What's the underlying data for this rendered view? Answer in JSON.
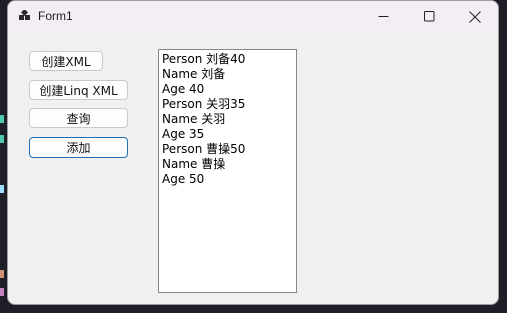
{
  "window": {
    "title": "Form1",
    "icon": "winforms-app-icon"
  },
  "caption_buttons": {
    "minimize": "minimize-icon",
    "maximize": "maximize-icon",
    "close": "close-icon"
  },
  "buttons": {
    "create_xml": "创建XML",
    "create_linq_xml": "创建Linq XML",
    "query": "查询",
    "add": "添加"
  },
  "listbox": {
    "items": [
      "Person 刘备40",
      "Name 刘备",
      "Age 40",
      "Person 关羽35",
      "Name 关羽",
      "Age 35",
      "Person 曹操50",
      "Name 曹操",
      "Age 50"
    ]
  },
  "colors": {
    "window_bg": "#f0f0f0",
    "titlebar_bg": "#f3eef4",
    "focus_border": "#1f6fb7"
  }
}
